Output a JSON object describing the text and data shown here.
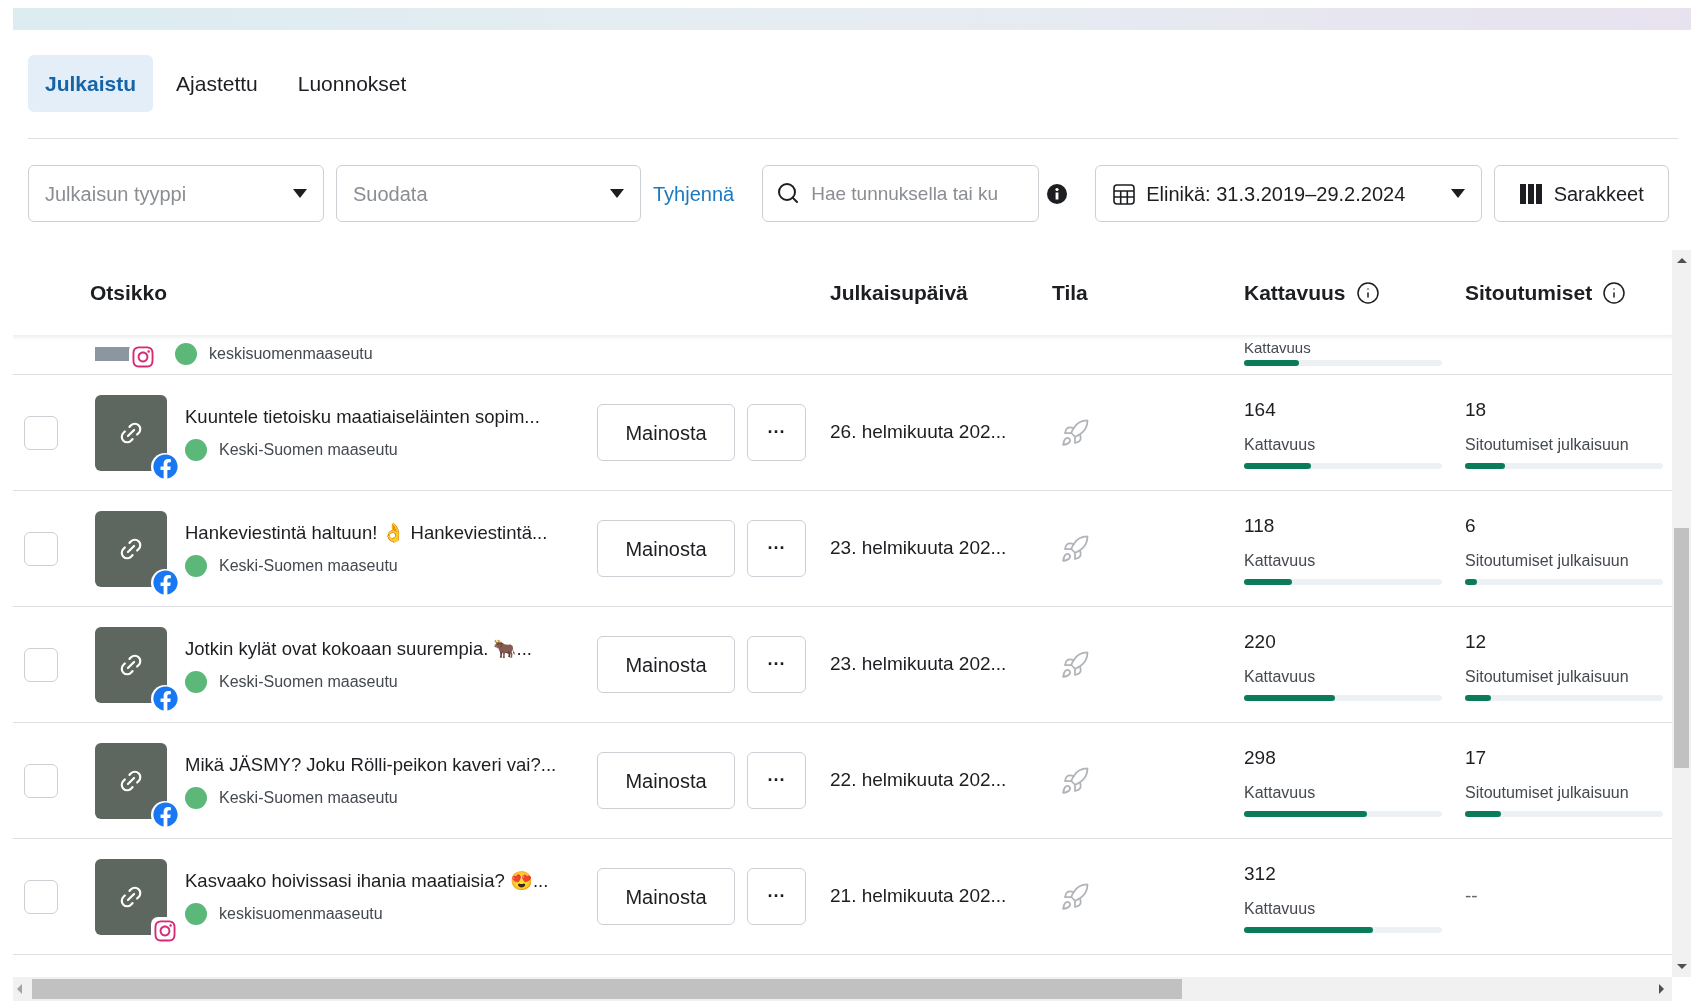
{
  "tabs": [
    {
      "label": "Julkaistu",
      "selected": true
    },
    {
      "label": "Ajastettu",
      "selected": false
    },
    {
      "label": "Luonnokset",
      "selected": false
    }
  ],
  "filters": {
    "post_type": {
      "placeholder": "Julkaisun tyyppi"
    },
    "filter": {
      "placeholder": "Suodata"
    },
    "clear": "Tyhjennä",
    "search": {
      "placeholder": "Hae tunnuksella tai ku"
    },
    "date_range": "Elinikä: 31.3.2019–29.2.2024",
    "columns_button": "Sarakkeet"
  },
  "table": {
    "columns": [
      "Otsikko",
      "Julkaisupäivä",
      "Tila",
      "Kattavuus",
      "Sitoutumiset"
    ],
    "partial_row": {
      "kind": "instagram",
      "account": "keskisuomenmaaseutu",
      "reach": {
        "label": "Kattavuus",
        "level": 0.28
      }
    },
    "rows": [
      {
        "checked": false,
        "kind": "facebook",
        "title": "Kuuntele tietoisku maatiaiseläinten sopim...",
        "account": "Keski-Suomen maaseutu",
        "promote": "Mainosta",
        "more": "···",
        "date": "26. helmikuuta 202...",
        "reach": {
          "value": "164",
          "label": "Kattavuus",
          "level": 0.34
        },
        "engagement": {
          "value": "18",
          "label": "Sitoutumiset julkaisuun",
          "level": 0.2
        }
      },
      {
        "checked": false,
        "kind": "facebook",
        "title": "Hankeviestintä haltuun! 👌 Hankeviestintä...",
        "account": "Keski-Suomen maaseutu",
        "promote": "Mainosta",
        "more": "···",
        "date": "23. helmikuuta 202...",
        "reach": {
          "value": "118",
          "label": "Kattavuus",
          "level": 0.24
        },
        "engagement": {
          "value": "6",
          "label": "Sitoutumiset julkaisuun",
          "level": 0.06
        }
      },
      {
        "checked": false,
        "kind": "facebook",
        "title": "Jotkin kylät ovat kokoaan suurempia. 🐂...",
        "account": "Keski-Suomen maaseutu",
        "promote": "Mainosta",
        "more": "···",
        "date": "23. helmikuuta 202...",
        "reach": {
          "value": "220",
          "label": "Kattavuus",
          "level": 0.46
        },
        "engagement": {
          "value": "12",
          "label": "Sitoutumiset julkaisuun",
          "level": 0.13
        }
      },
      {
        "checked": false,
        "kind": "facebook",
        "title": "Mikä JÄSMY? Joku Rölli-peikon kaveri vai?...",
        "account": "Keski-Suomen maaseutu",
        "promote": "Mainosta",
        "more": "···",
        "date": "22. helmikuuta 202...",
        "reach": {
          "value": "298",
          "label": "Kattavuus",
          "level": 0.62
        },
        "engagement": {
          "value": "17",
          "label": "Sitoutumiset julkaisuun",
          "level": 0.18
        }
      },
      {
        "checked": false,
        "kind": "instagram",
        "title": "Kasvaako hoivissasi ihania maatiaisia? 😍...",
        "account": "keskisuomenmaaseutu",
        "promote": "Mainosta",
        "more": "···",
        "date": "21. helmikuuta 202...",
        "reach": {
          "value": "312",
          "label": "Kattavuus",
          "level": 0.65
        },
        "engagement": {
          "value": "--"
        }
      }
    ]
  }
}
